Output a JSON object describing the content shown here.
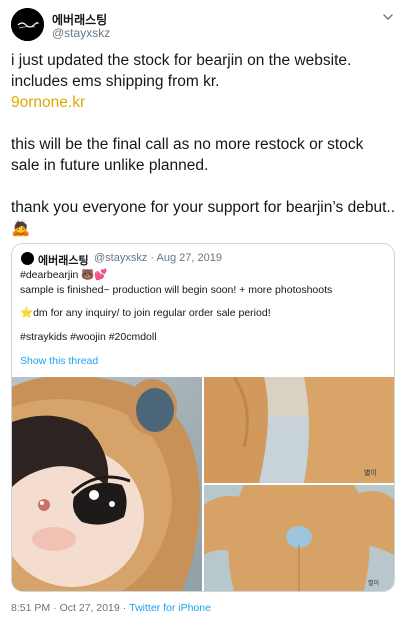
{
  "author": {
    "display_name": "에버래스팅",
    "handle": "@stayxskz",
    "avatar_text": "Everlasting"
  },
  "tweet": {
    "paragraph1": "i just updated the stock for bearjin on the website. includes ems shipping from kr.",
    "link": "9ornone.kr",
    "paragraph2": "this will be the final call as no more restock or stock sale in future unlike planned.",
    "paragraph3": "thank you everyone for your support for bearjin’s debut..🙇"
  },
  "quoted": {
    "display_name": "에버래스팅",
    "handle": "@stayxskz",
    "date": "Aug 27, 2019",
    "line1": "#dearbearjin 🐻💕",
    "line2": "sample is finished~ production will begin soon! + more photoshoots",
    "line3": "⭐dm for any inquiry/ to join regular order sale period!",
    "line4": "#straykids #woojin #20cmdoll",
    "show_thread": "Show this thread",
    "media": [
      {
        "name": "doll-face-photo"
      },
      {
        "name": "doll-back-photo"
      },
      {
        "name": "doll-tail-photo"
      }
    ]
  },
  "footer": {
    "time": "8:51 PM",
    "date": "Oct 27, 2019",
    "source": "Twitter for iPhone"
  },
  "colors": {
    "link": "#e0a800",
    "accent": "#1da1f2",
    "muted": "#657786",
    "border": "#ccd6dd"
  }
}
